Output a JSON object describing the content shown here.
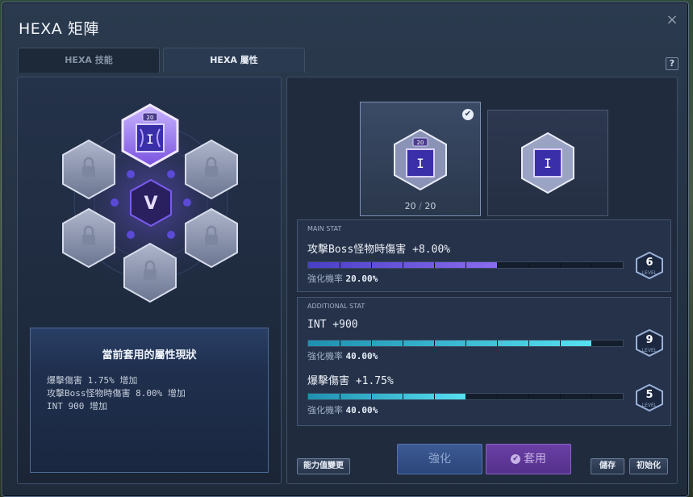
{
  "window": {
    "title": "HEXA 矩陣"
  },
  "tabs": [
    {
      "label": "HEXA 技能",
      "active": false
    },
    {
      "label": "HEXA 屬性",
      "active": true
    }
  ],
  "help_label": "?",
  "close_label": "×",
  "hex_grid": {
    "active_badge": "20",
    "active_glyph": "I",
    "center_glyph": "V"
  },
  "status_box": {
    "title": "當前套用的屬性現狀",
    "lines": [
      "爆擊傷害 1.75% 增加",
      "攻擊Boss怪物時傷害 8.00% 增加",
      "INT 900 增加"
    ]
  },
  "cores": {
    "card1": {
      "badge": "20",
      "glyph": "I",
      "progress": "20",
      "separator": "/",
      "max": "20",
      "check": "✔"
    },
    "card2": {
      "glyph": "I"
    }
  },
  "main_stat": {
    "label": "MAIN STAT",
    "name": "攻擊Boss怪物時傷害 +8.00%",
    "rate_label": "強化機率",
    "rate_value": "20.00%",
    "level": "6",
    "level_word": "LEVEL",
    "fill": 0.6
  },
  "additional_stat": {
    "label": "ADDITIONAL STAT",
    "stats": [
      {
        "name": "INT +900",
        "rate_label": "強化機率",
        "rate_value": "40.00%",
        "level": "9",
        "level_word": "LEVEL",
        "fill": 0.9
      },
      {
        "name": "爆擊傷害 +1.75%",
        "rate_label": "強化機率",
        "rate_value": "40.00%",
        "level": "5",
        "level_word": "LEVEL",
        "fill": 0.5
      }
    ]
  },
  "buttons": {
    "ability_change": "能力值變更",
    "enhance": "強化",
    "apply": "套用",
    "save": "儲存",
    "reset": "初始化"
  },
  "colors": {
    "main_bar": "#7a63e6",
    "add_bar": "#3fc7e0",
    "accent_purple": "#8a62c6",
    "accent_blue": "#3c5a94"
  }
}
